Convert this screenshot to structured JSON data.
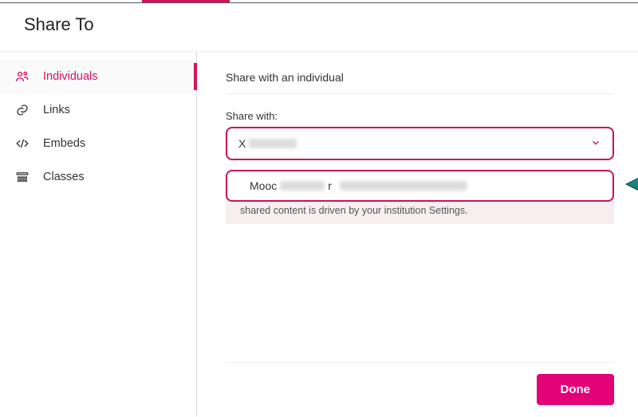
{
  "header": {
    "title": "Share To"
  },
  "sidebar": {
    "items": [
      {
        "label": "Individuals",
        "icon": "people-icon",
        "selected": true
      },
      {
        "label": "Links",
        "icon": "link-icon"
      },
      {
        "label": "Embeds",
        "icon": "code-icon"
      },
      {
        "label": "Classes",
        "icon": "classes-icon"
      }
    ]
  },
  "main": {
    "section_title": "Share with an individual",
    "field_label": "Share with:",
    "combo_value_prefix": "X",
    "dropdown_option_prefix": "Mooc",
    "dropdown_option_mid": "r",
    "note_text": "shared content is driven by your institution Settings."
  },
  "footer": {
    "done_label": "Done"
  },
  "colors": {
    "accent": "#d5115c",
    "button": "#e20177",
    "arrow": "#187a7d"
  }
}
